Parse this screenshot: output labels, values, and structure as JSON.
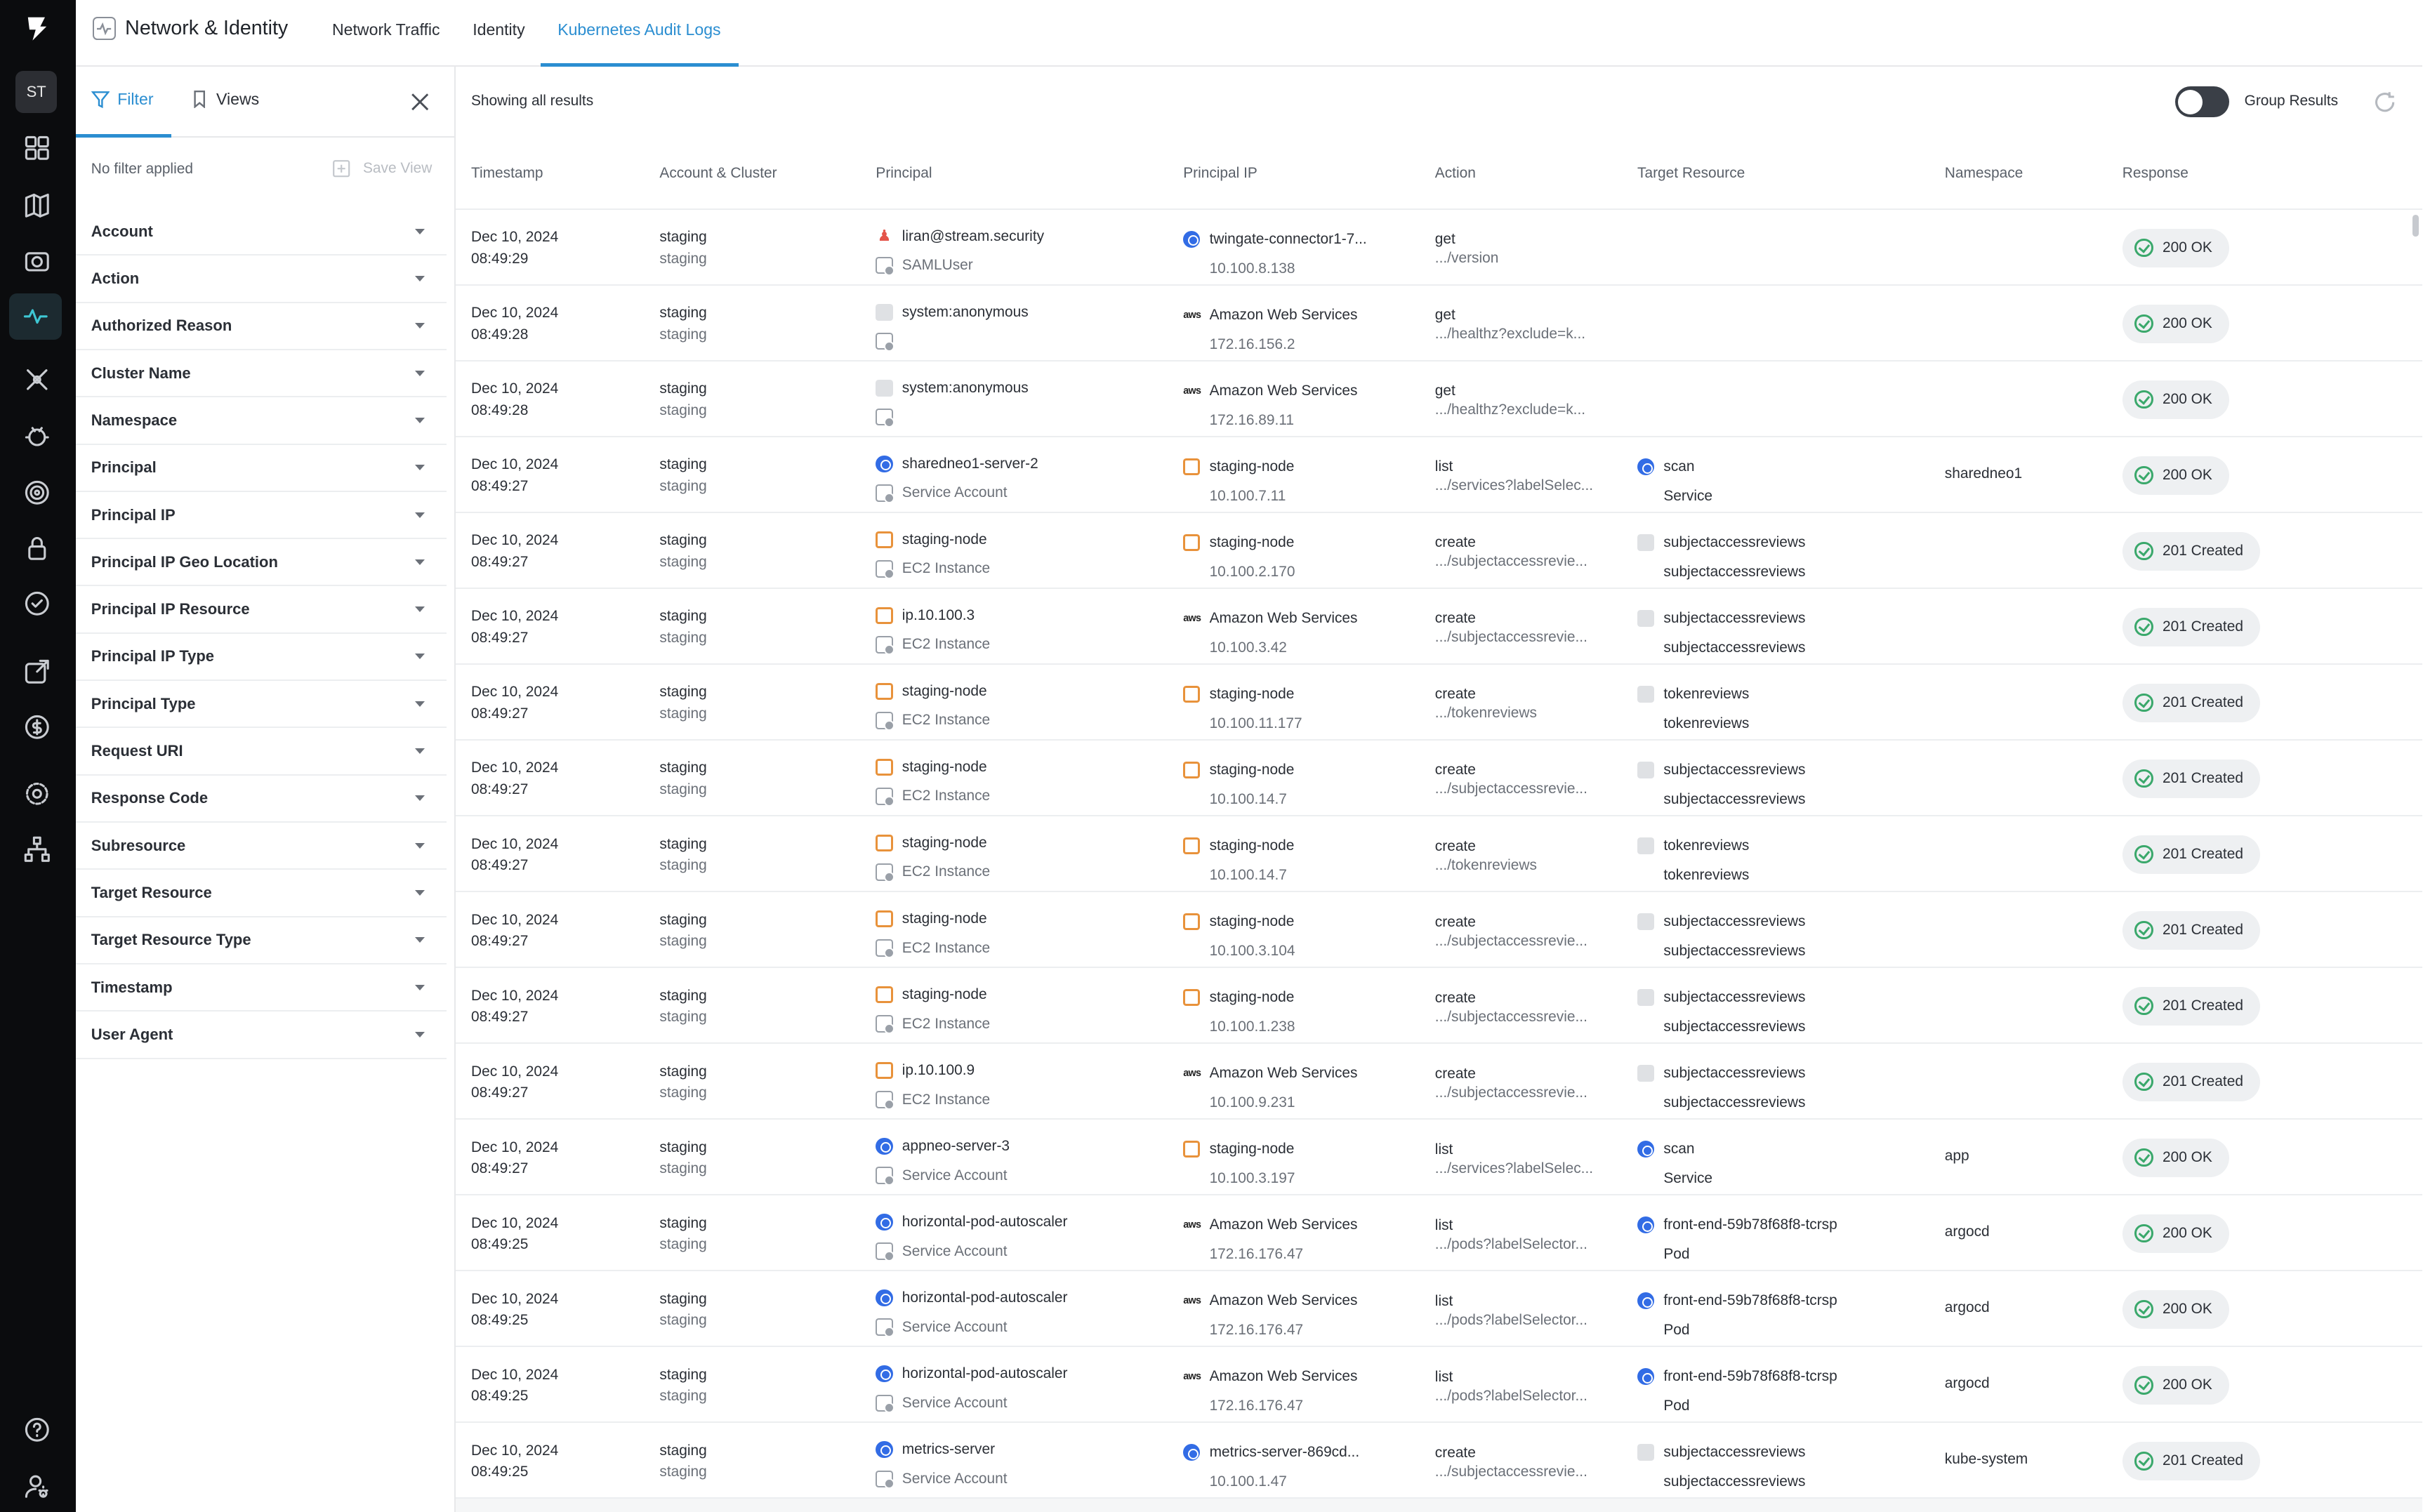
{
  "rail": {
    "avatar": "ST",
    "icons": [
      "dashboard-icon",
      "map-icon",
      "camera-icon",
      "network-activity-icon",
      "scan-icon",
      "bug-icon",
      "target-icon",
      "lock-icon",
      "check-circle-icon",
      "export-icon",
      "dollar-icon",
      "settings-icon",
      "org-chart-icon",
      "help-icon",
      "user-settings-icon"
    ]
  },
  "header": {
    "title": "Network & Identity",
    "tabs": [
      "Network Traffic",
      "Identity",
      "Kubernetes Audit Logs"
    ],
    "active_tab": "Kubernetes Audit Logs"
  },
  "filter_panel": {
    "filter_tab": "Filter",
    "views_tab": "Views",
    "no_filter": "No filter applied",
    "save_view": "Save View",
    "filters": [
      "Account",
      "Action",
      "Authorized Reason",
      "Cluster Name",
      "Namespace",
      "Principal",
      "Principal IP",
      "Principal IP Geo Location",
      "Principal IP Resource",
      "Principal IP Type",
      "Principal Type",
      "Request URI",
      "Response Code",
      "Subresource",
      "Target Resource",
      "Target Resource Type",
      "Timestamp",
      "User Agent"
    ]
  },
  "results": {
    "showing": "Showing all results",
    "group_label": "Group Results",
    "columns": [
      "Timestamp",
      "Account & Cluster",
      "Principal",
      "Principal IP",
      "Action",
      "Target Resource",
      "Namespace",
      "Response"
    ],
    "rows": [
      {
        "date": "Dec 10, 2024",
        "time": "08:49:29",
        "account": "staging",
        "cluster": "staging",
        "principal": "liran@stream.security",
        "principal_icon": "user",
        "principal_type": "SAMLUser",
        "ip_name": "twingate-connector1-7...",
        "ip_icon": "k8s",
        "ip": "10.100.8.138",
        "action": "get",
        "uri": ".../version",
        "target": "",
        "target_icon": "",
        "target_type": "",
        "namespace": "",
        "response": "200 OK"
      },
      {
        "date": "Dec 10, 2024",
        "time": "08:49:28",
        "account": "staging",
        "cluster": "staging",
        "principal": "system:anonymous",
        "principal_icon": "gray",
        "principal_type": "",
        "ip_name": "Amazon Web Services",
        "ip_icon": "aws",
        "ip": "172.16.156.2",
        "action": "get",
        "uri": ".../healthz?exclude=k...",
        "target": "",
        "target_icon": "",
        "target_type": "",
        "namespace": "",
        "response": "200 OK"
      },
      {
        "date": "Dec 10, 2024",
        "time": "08:49:28",
        "account": "staging",
        "cluster": "staging",
        "principal": "system:anonymous",
        "principal_icon": "gray",
        "principal_type": "",
        "ip_name": "Amazon Web Services",
        "ip_icon": "aws",
        "ip": "172.16.89.11",
        "action": "get",
        "uri": ".../healthz?exclude=k...",
        "target": "",
        "target_icon": "",
        "target_type": "",
        "namespace": "",
        "response": "200 OK"
      },
      {
        "date": "Dec 10, 2024",
        "time": "08:49:27",
        "account": "staging",
        "cluster": "staging",
        "principal": "sharedneo1-server-2",
        "principal_icon": "k8s",
        "principal_type": "Service Account",
        "ip_name": "staging-node",
        "ip_icon": "orange",
        "ip": "10.100.7.11",
        "action": "list",
        "uri": ".../services?labelSelec...",
        "target": "scan",
        "target_icon": "k8s",
        "target_type": "Service",
        "namespace": "sharedneo1",
        "response": "200 OK"
      },
      {
        "date": "Dec 10, 2024",
        "time": "08:49:27",
        "account": "staging",
        "cluster": "staging",
        "principal": "staging-node",
        "principal_icon": "orange",
        "principal_type": "EC2 Instance",
        "ip_name": "staging-node",
        "ip_icon": "orange",
        "ip": "10.100.2.170",
        "action": "create",
        "uri": ".../subjectaccessrevie...",
        "target": "subjectaccessreviews",
        "target_icon": "gray",
        "target_type": "subjectaccessreviews",
        "namespace": "",
        "response": "201 Created"
      },
      {
        "date": "Dec 10, 2024",
        "time": "08:49:27",
        "account": "staging",
        "cluster": "staging",
        "principal": "ip.10.100.3",
        "principal_icon": "orange",
        "principal_type": "EC2 Instance",
        "ip_name": "Amazon Web Services",
        "ip_icon": "aws",
        "ip": "10.100.3.42",
        "action": "create",
        "uri": ".../subjectaccessrevie...",
        "target": "subjectaccessreviews",
        "target_icon": "gray",
        "target_type": "subjectaccessreviews",
        "namespace": "",
        "response": "201 Created"
      },
      {
        "date": "Dec 10, 2024",
        "time": "08:49:27",
        "account": "staging",
        "cluster": "staging",
        "principal": "staging-node",
        "principal_icon": "orange",
        "principal_type": "EC2 Instance",
        "ip_name": "staging-node",
        "ip_icon": "orange",
        "ip": "10.100.11.177",
        "action": "create",
        "uri": ".../tokenreviews",
        "target": "tokenreviews",
        "target_icon": "gray",
        "target_type": "tokenreviews",
        "namespace": "",
        "response": "201 Created"
      },
      {
        "date": "Dec 10, 2024",
        "time": "08:49:27",
        "account": "staging",
        "cluster": "staging",
        "principal": "staging-node",
        "principal_icon": "orange",
        "principal_type": "EC2 Instance",
        "ip_name": "staging-node",
        "ip_icon": "orange",
        "ip": "10.100.14.7",
        "action": "create",
        "uri": ".../subjectaccessrevie...",
        "target": "subjectaccessreviews",
        "target_icon": "gray",
        "target_type": "subjectaccessreviews",
        "namespace": "",
        "response": "201 Created"
      },
      {
        "date": "Dec 10, 2024",
        "time": "08:49:27",
        "account": "staging",
        "cluster": "staging",
        "principal": "staging-node",
        "principal_icon": "orange",
        "principal_type": "EC2 Instance",
        "ip_name": "staging-node",
        "ip_icon": "orange",
        "ip": "10.100.14.7",
        "action": "create",
        "uri": ".../tokenreviews",
        "target": "tokenreviews",
        "target_icon": "gray",
        "target_type": "tokenreviews",
        "namespace": "",
        "response": "201 Created"
      },
      {
        "date": "Dec 10, 2024",
        "time": "08:49:27",
        "account": "staging",
        "cluster": "staging",
        "principal": "staging-node",
        "principal_icon": "orange",
        "principal_type": "EC2 Instance",
        "ip_name": "staging-node",
        "ip_icon": "orange",
        "ip": "10.100.3.104",
        "action": "create",
        "uri": ".../subjectaccessrevie...",
        "target": "subjectaccessreviews",
        "target_icon": "gray",
        "target_type": "subjectaccessreviews",
        "namespace": "",
        "response": "201 Created"
      },
      {
        "date": "Dec 10, 2024",
        "time": "08:49:27",
        "account": "staging",
        "cluster": "staging",
        "principal": "staging-node",
        "principal_icon": "orange",
        "principal_type": "EC2 Instance",
        "ip_name": "staging-node",
        "ip_icon": "orange",
        "ip": "10.100.1.238",
        "action": "create",
        "uri": ".../subjectaccessrevie...",
        "target": "subjectaccessreviews",
        "target_icon": "gray",
        "target_type": "subjectaccessreviews",
        "namespace": "",
        "response": "201 Created"
      },
      {
        "date": "Dec 10, 2024",
        "time": "08:49:27",
        "account": "staging",
        "cluster": "staging",
        "principal": "ip.10.100.9",
        "principal_icon": "orange",
        "principal_type": "EC2 Instance",
        "ip_name": "Amazon Web Services",
        "ip_icon": "aws",
        "ip": "10.100.9.231",
        "action": "create",
        "uri": ".../subjectaccessrevie...",
        "target": "subjectaccessreviews",
        "target_icon": "gray",
        "target_type": "subjectaccessreviews",
        "namespace": "",
        "response": "201 Created"
      },
      {
        "date": "Dec 10, 2024",
        "time": "08:49:27",
        "account": "staging",
        "cluster": "staging",
        "principal": "appneo-server-3",
        "principal_icon": "k8s",
        "principal_type": "Service Account",
        "ip_name": "staging-node",
        "ip_icon": "orange",
        "ip": "10.100.3.197",
        "action": "list",
        "uri": ".../services?labelSelec...",
        "target": "scan",
        "target_icon": "k8s",
        "target_type": "Service",
        "namespace": "app",
        "response": "200 OK"
      },
      {
        "date": "Dec 10, 2024",
        "time": "08:49:25",
        "account": "staging",
        "cluster": "staging",
        "principal": "horizontal-pod-autoscaler",
        "principal_icon": "k8s",
        "principal_type": "Service Account",
        "ip_name": "Amazon Web Services",
        "ip_icon": "aws",
        "ip": "172.16.176.47",
        "action": "list",
        "uri": ".../pods?labelSelector...",
        "target": "front-end-59b78f68f8-tcrsp",
        "target_icon": "k8s",
        "target_type": "Pod",
        "namespace": "argocd",
        "response": "200 OK"
      },
      {
        "date": "Dec 10, 2024",
        "time": "08:49:25",
        "account": "staging",
        "cluster": "staging",
        "principal": "horizontal-pod-autoscaler",
        "principal_icon": "k8s",
        "principal_type": "Service Account",
        "ip_name": "Amazon Web Services",
        "ip_icon": "aws",
        "ip": "172.16.176.47",
        "action": "list",
        "uri": ".../pods?labelSelector...",
        "target": "front-end-59b78f68f8-tcrsp",
        "target_icon": "k8s",
        "target_type": "Pod",
        "namespace": "argocd",
        "response": "200 OK"
      },
      {
        "date": "Dec 10, 2024",
        "time": "08:49:25",
        "account": "staging",
        "cluster": "staging",
        "principal": "horizontal-pod-autoscaler",
        "principal_icon": "k8s",
        "principal_type": "Service Account",
        "ip_name": "Amazon Web Services",
        "ip_icon": "aws",
        "ip": "172.16.176.47",
        "action": "list",
        "uri": ".../pods?labelSelector...",
        "target": "front-end-59b78f68f8-tcrsp",
        "target_icon": "k8s",
        "target_type": "Pod",
        "namespace": "argocd",
        "response": "200 OK"
      },
      {
        "date": "Dec 10, 2024",
        "time": "08:49:25",
        "account": "staging",
        "cluster": "staging",
        "principal": "metrics-server",
        "principal_icon": "k8s",
        "principal_type": "Service Account",
        "ip_name": "metrics-server-869cd...",
        "ip_icon": "k8s",
        "ip": "10.100.1.47",
        "action": "create",
        "uri": ".../subjectaccessrevie...",
        "target": "subjectaccessreviews",
        "target_icon": "gray",
        "target_type": "subjectaccessreviews",
        "namespace": "kube-system",
        "response": "201 Created"
      }
    ]
  },
  "colors": {
    "accent": "#2b8ed1",
    "rail_bg": "#0b0c0e",
    "success": "#3aa86b",
    "orange": "#e8923b",
    "k8s_blue": "#326ce5"
  }
}
